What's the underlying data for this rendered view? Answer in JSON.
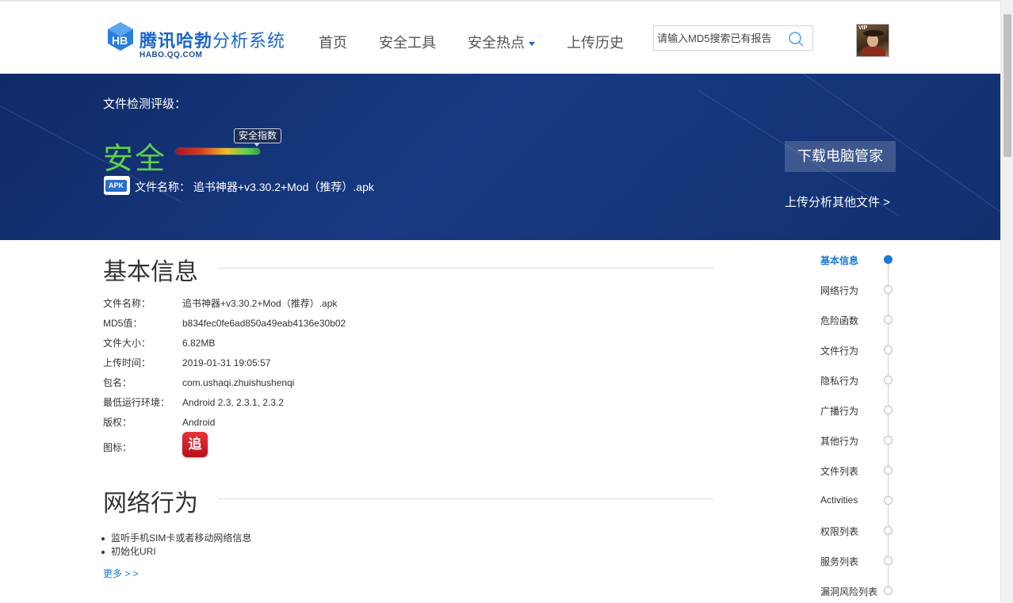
{
  "header": {
    "logo_text_bold": "腾讯哈勃",
    "logo_text_light": "分析系统",
    "logo_sub": "HABO.QQ.COM",
    "nav": [
      {
        "label": "首页"
      },
      {
        "label": "安全工具"
      },
      {
        "label": "安全热点"
      },
      {
        "label": "上传历史"
      }
    ],
    "search_placeholder": "请输入MD5搜索已有报告",
    "avatar_badge": "VIP"
  },
  "banner": {
    "rating_label": "文件检测评级：",
    "rating_value": "安全",
    "meter_tag": "安全指数",
    "file_icon_text": "APK",
    "file_name_line": "文件名称：  追书神器+v3.30.2+Mod（推荐）.apk",
    "download_button": "下载电脑管家",
    "upload_link": "上传分析其他文件 >"
  },
  "basic_info": {
    "title": "基本信息",
    "rows": [
      {
        "key": "文件名称：",
        "value": "追书神器+v3.30.2+Mod（推荐）.apk"
      },
      {
        "key": "MD5值：",
        "value": "b834fec0fe6ad850a49eab4136e30b02"
      },
      {
        "key": "文件大小：",
        "value": "6.82MB"
      },
      {
        "key": "上传时间：",
        "value": "2019-01-31 19:05:57"
      },
      {
        "key": "包名：",
        "value": "com.ushaqi.zhuishushenqi"
      },
      {
        "key": "最低运行环境：",
        "value": "Android 2.3, 2.3.1, 2.3.2"
      },
      {
        "key": "版权：",
        "value": "Android"
      }
    ],
    "icon_label": "图标：",
    "app_icon_glyph": "追"
  },
  "network": {
    "title": "网络行为",
    "items": [
      "监听手机SIM卡或者移动网络信息",
      "初始化URI"
    ],
    "more": "更多 > >"
  },
  "side_nav": [
    {
      "label": "基本信息",
      "active": true
    },
    {
      "label": "网络行为"
    },
    {
      "label": "危险函数"
    },
    {
      "label": "文件行为"
    },
    {
      "label": "隐私行为"
    },
    {
      "label": "广播行为"
    },
    {
      "label": "其他行为"
    },
    {
      "label": "文件列表"
    },
    {
      "label": "Activities"
    },
    {
      "label": "权限列表"
    },
    {
      "label": "服务列表"
    },
    {
      "label": "漏洞风险列表"
    }
  ],
  "colors": {
    "brand_blue": "#1b66c9",
    "banner_bg": "#143070",
    "safe_green": "#5fd04a",
    "link_blue": "#1b7ad4"
  }
}
